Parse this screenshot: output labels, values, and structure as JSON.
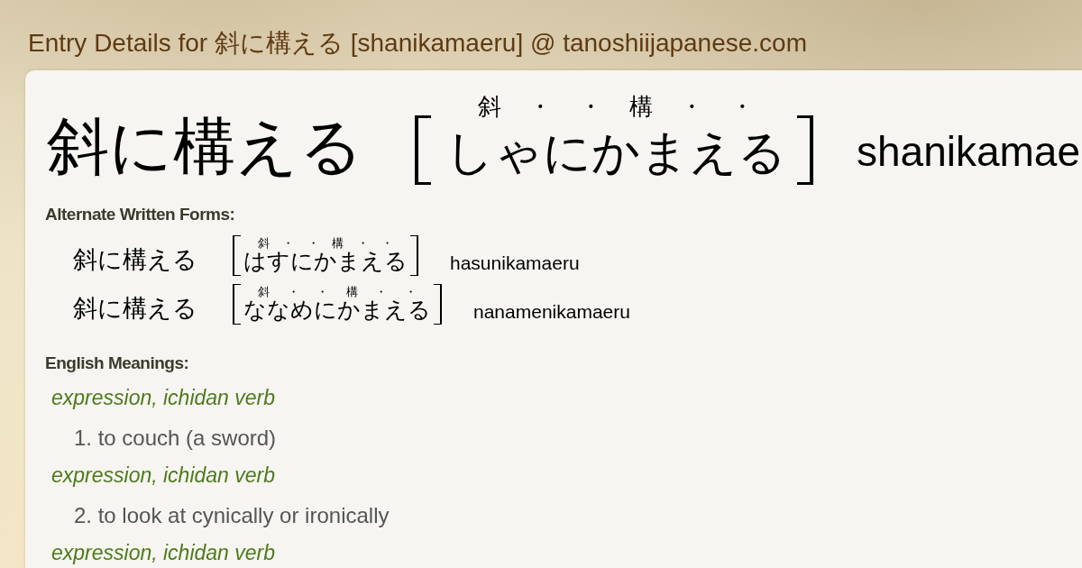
{
  "header": {
    "title": "Entry Details for 斜に構える [shanikamaeru] @ tanoshiijapanese.com"
  },
  "entry": {
    "word": "斜に構える",
    "ruby": [
      "斜",
      "・",
      "・",
      "構",
      "・",
      "・"
    ],
    "reading": "しゃにかまえる",
    "romaji": "shanikamae"
  },
  "alternate_forms": {
    "label": "Alternate Written Forms:",
    "items": [
      {
        "word": "斜に構える",
        "ruby": [
          "斜",
          "・",
          "・",
          "構",
          "・",
          "・"
        ],
        "reading": "はすにかまえる",
        "romaji": "hasunikamaeru"
      },
      {
        "word": "斜に構える",
        "ruby": [
          "斜",
          "・",
          "・",
          "構",
          "・",
          "・"
        ],
        "reading": "ななめにかまえる",
        "romaji": "nanamenikamaeru"
      }
    ]
  },
  "meanings": {
    "label": "English Meanings:",
    "items": [
      {
        "kind": "pos",
        "text": "expression, ichidan verb"
      },
      {
        "kind": "sense",
        "text": "1. to couch (a sword)"
      },
      {
        "kind": "pos",
        "text": "expression, ichidan verb"
      },
      {
        "kind": "sense",
        "text": "2. to look at cynically or ironically"
      },
      {
        "kind": "pos",
        "text": "expression, ichidan verb"
      }
    ]
  }
}
